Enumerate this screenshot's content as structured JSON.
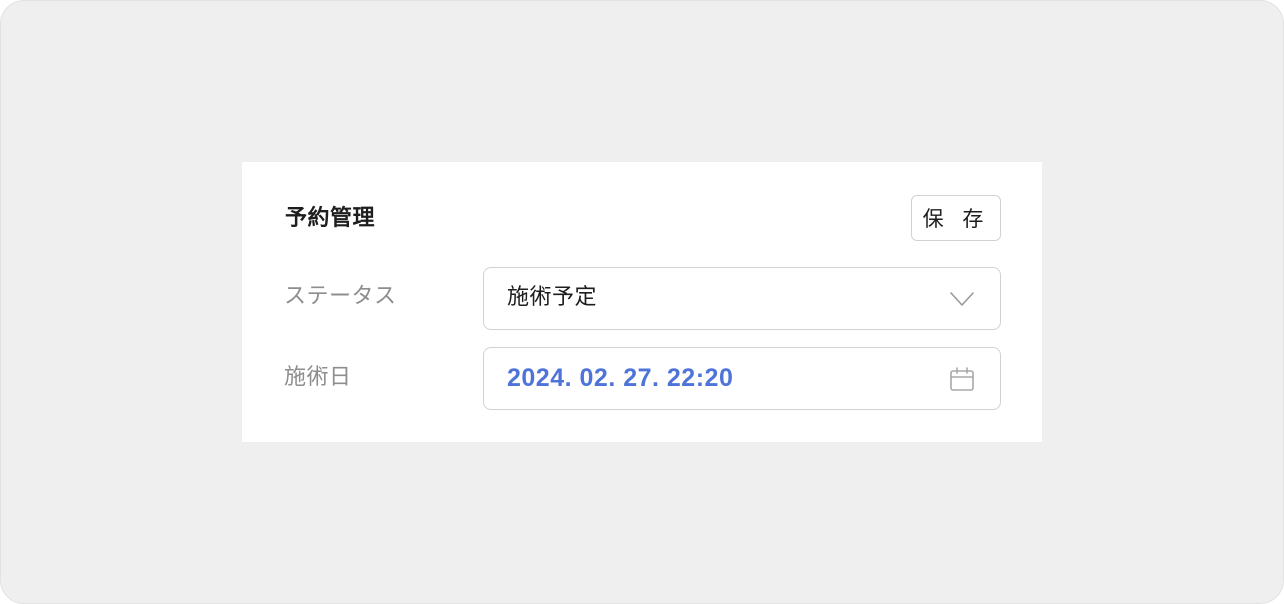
{
  "panel": {
    "title": "予約管理",
    "save_label": "保 存"
  },
  "status_row": {
    "label": "ステータス",
    "value": "施術予定",
    "icon": "chevron-down-icon"
  },
  "date_row": {
    "label": "施術日",
    "value": "2024. 02. 27. 22:20",
    "icon": "calendar-icon"
  },
  "colors": {
    "background": "#efefef",
    "card": "#ffffff",
    "accent": "#4f74d9",
    "label": "#8e8e8e",
    "border": "#d2d2d2"
  }
}
